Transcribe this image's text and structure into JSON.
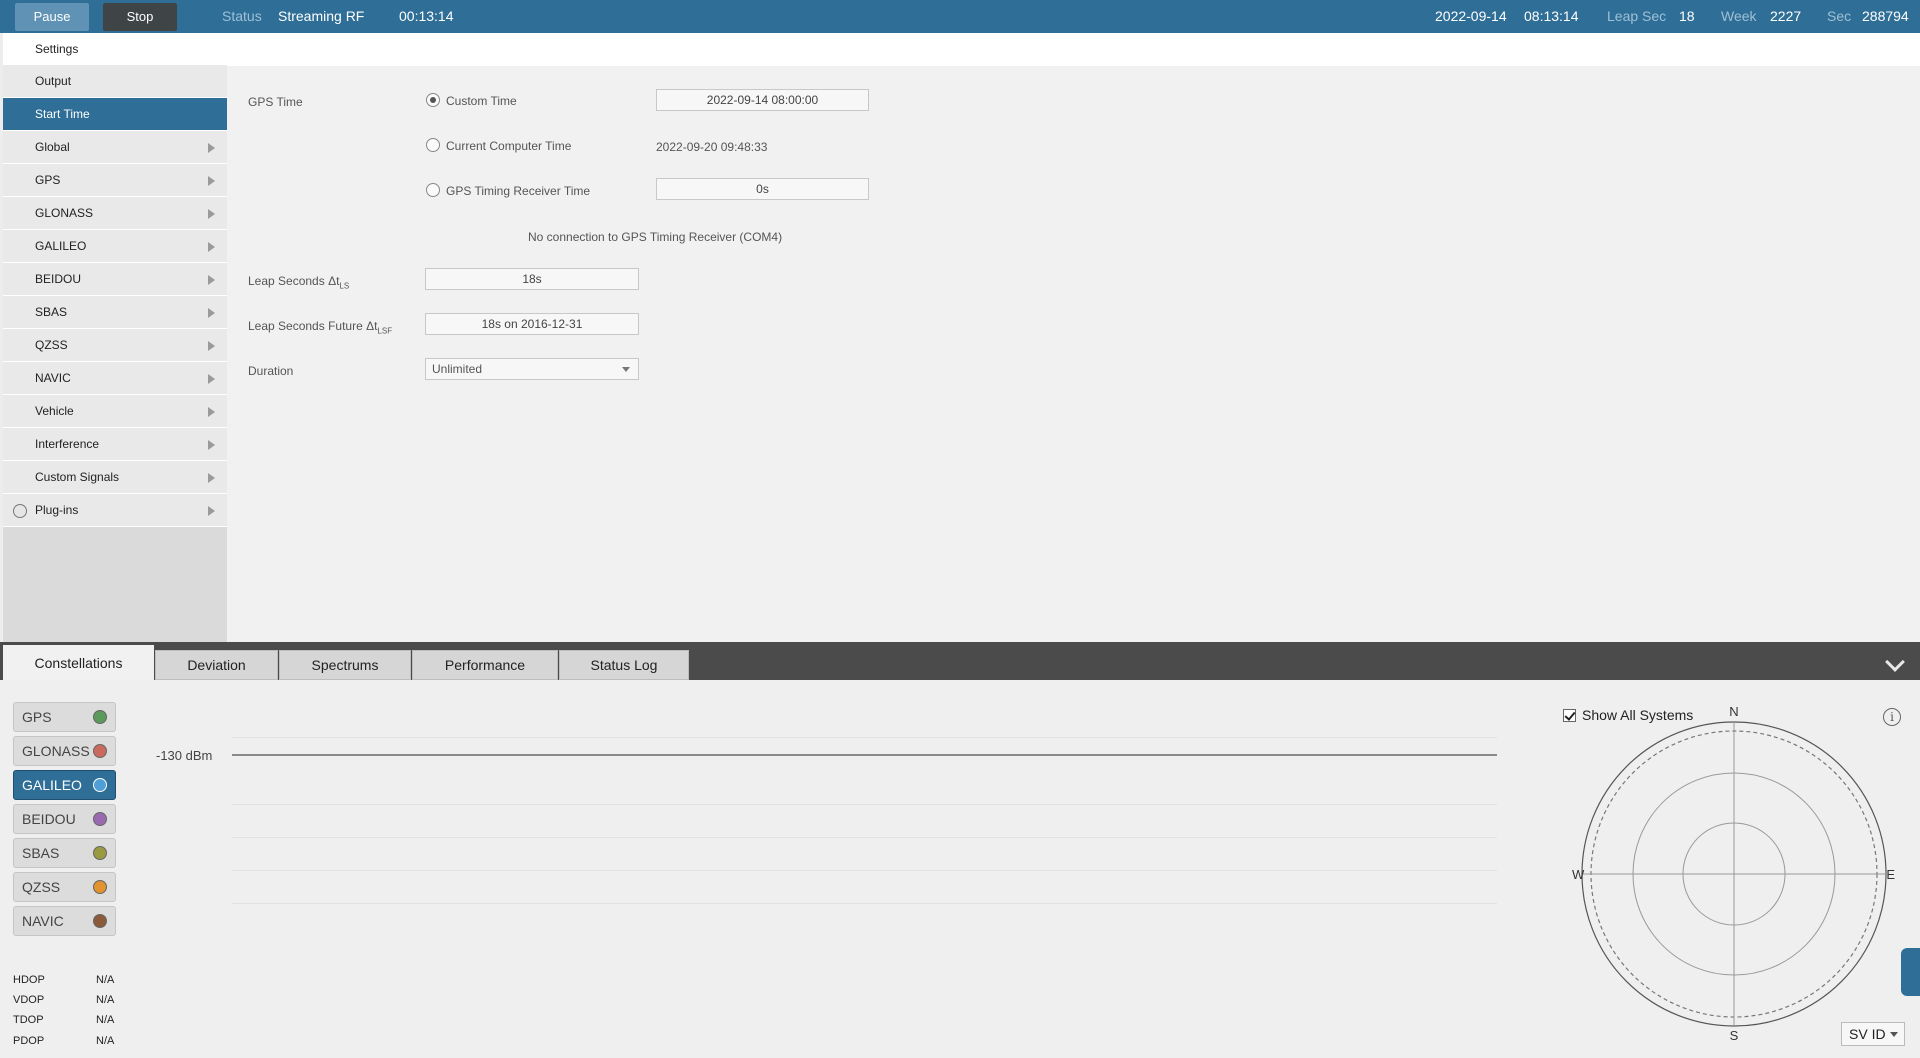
{
  "topbar": {
    "pause_label": "Pause",
    "stop_label": "Stop",
    "status_label": "Status",
    "status_value": "Streaming RF",
    "elapsed": "00:13:14",
    "date": "2022-09-14",
    "time": "08:13:14",
    "leap_sec_label": "Leap Sec",
    "leap_sec_value": "18",
    "week_label": "Week",
    "week_value": "2227",
    "sec_label": "Sec",
    "sec_value": "288794"
  },
  "sidebar": {
    "header": "Settings",
    "items": [
      {
        "label": "Output"
      },
      {
        "label": "Start Time"
      },
      {
        "label": "Global"
      },
      {
        "label": "GPS"
      },
      {
        "label": "GLONASS"
      },
      {
        "label": "GALILEO"
      },
      {
        "label": "BEIDOU"
      },
      {
        "label": "SBAS"
      },
      {
        "label": "QZSS"
      },
      {
        "label": "NAVIC"
      },
      {
        "label": "Vehicle"
      },
      {
        "label": "Interference"
      },
      {
        "label": "Custom Signals"
      },
      {
        "label": "Plug-ins"
      }
    ]
  },
  "start_time": {
    "gps_time_label": "GPS Time",
    "custom_time_label": "Custom Time",
    "custom_time_value": "2022-09-14 08:00:00",
    "current_computer_time_label": "Current Computer Time",
    "current_computer_time_value": "2022-09-20 09:48:33",
    "receiver_time_label": "GPS Timing Receiver Time",
    "receiver_time_value": "0s",
    "no_connection_text": "No connection to GPS Timing Receiver (COM4)",
    "leap_seconds_label": "Leap Seconds Δt",
    "leap_seconds_sub": "LS",
    "leap_seconds_value": "18s",
    "leap_future_label": "Leap Seconds Future Δt",
    "leap_future_sub": "LSF",
    "leap_future_value": "18s on 2016-12-31",
    "duration_label": "Duration",
    "duration_value": "Unlimited"
  },
  "tabs": [
    {
      "label": "Constellations"
    },
    {
      "label": "Deviation"
    },
    {
      "label": "Spectrums"
    },
    {
      "label": "Performance"
    },
    {
      "label": "Status Log"
    }
  ],
  "constellations": [
    {
      "label": "GPS",
      "color": "#5a9a5a"
    },
    {
      "label": "GLONASS",
      "color": "#c96a5f"
    },
    {
      "label": "GALILEO",
      "color": "#4f9fd6"
    },
    {
      "label": "BEIDOU",
      "color": "#9a6ab0"
    },
    {
      "label": "SBAS",
      "color": "#9a9a40"
    },
    {
      "label": "QZSS",
      "color": "#e0932e"
    },
    {
      "label": "NAVIC",
      "color": "#8a5a3a"
    }
  ],
  "dop": [
    {
      "label": "HDOP",
      "value": "N/A"
    },
    {
      "label": "VDOP",
      "value": "N/A"
    },
    {
      "label": "TDOP",
      "value": "N/A"
    },
    {
      "label": "PDOP",
      "value": "N/A"
    }
  ],
  "signal": {
    "level_label": "-130 dBm"
  },
  "skyplot": {
    "show_all_label": "Show All Systems",
    "north": "N",
    "south": "S",
    "east": "E",
    "west": "W",
    "sv_id_label": "SV ID"
  }
}
